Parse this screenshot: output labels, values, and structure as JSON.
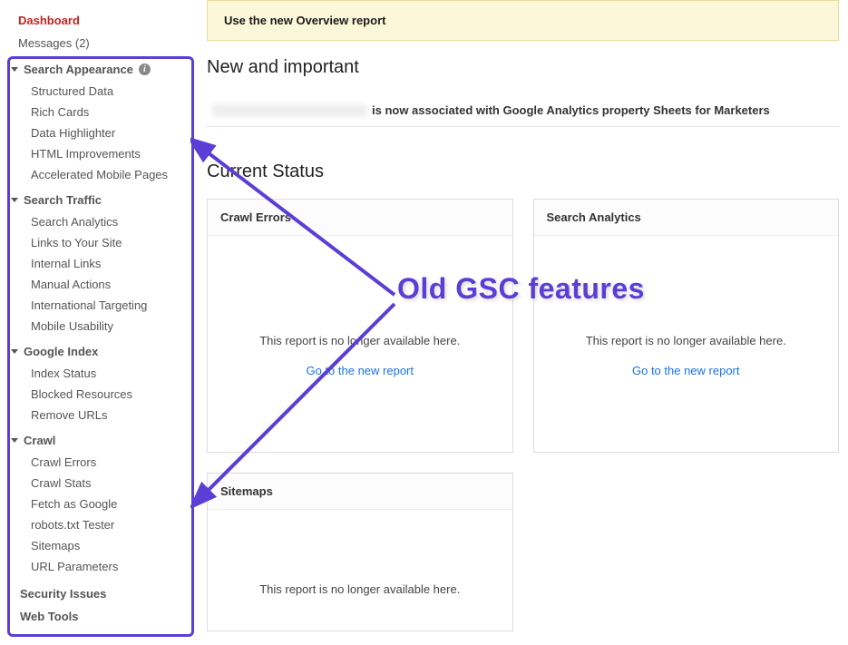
{
  "sidebar": {
    "dashboard": "Dashboard",
    "messages": "Messages (2)",
    "sections": [
      {
        "title": "Search Appearance",
        "info": true,
        "items": [
          "Structured Data",
          "Rich Cards",
          "Data Highlighter",
          "HTML Improvements",
          "Accelerated Mobile Pages"
        ]
      },
      {
        "title": "Search Traffic",
        "info": false,
        "items": [
          "Search Analytics",
          "Links to Your Site",
          "Internal Links",
          "Manual Actions",
          "International Targeting",
          "Mobile Usability"
        ]
      },
      {
        "title": "Google Index",
        "info": false,
        "items": [
          "Index Status",
          "Blocked Resources",
          "Remove URLs"
        ]
      },
      {
        "title": "Crawl",
        "info": false,
        "items": [
          "Crawl Errors",
          "Crawl Stats",
          "Fetch as Google",
          "robots.txt Tester",
          "Sitemaps",
          "URL Parameters"
        ]
      }
    ],
    "security": "Security Issues",
    "webtools": "Web Tools"
  },
  "banner": {
    "text": "Use the new Overview report"
  },
  "new_important": {
    "title": "New and important",
    "notice_suffix": "is now associated with Google Analytics property Sheets for Marketers"
  },
  "current_status": {
    "title": "Current Status",
    "cards": [
      {
        "title": "Crawl Errors",
        "body": "This report is no longer available here.",
        "link": "Go to the new report"
      },
      {
        "title": "Search Analytics",
        "body": "This report is no longer available here.",
        "link": "Go to the new report"
      },
      {
        "title": "Sitemaps",
        "body": "This report is no longer available here."
      }
    ]
  },
  "annotation": "Old GSC features"
}
